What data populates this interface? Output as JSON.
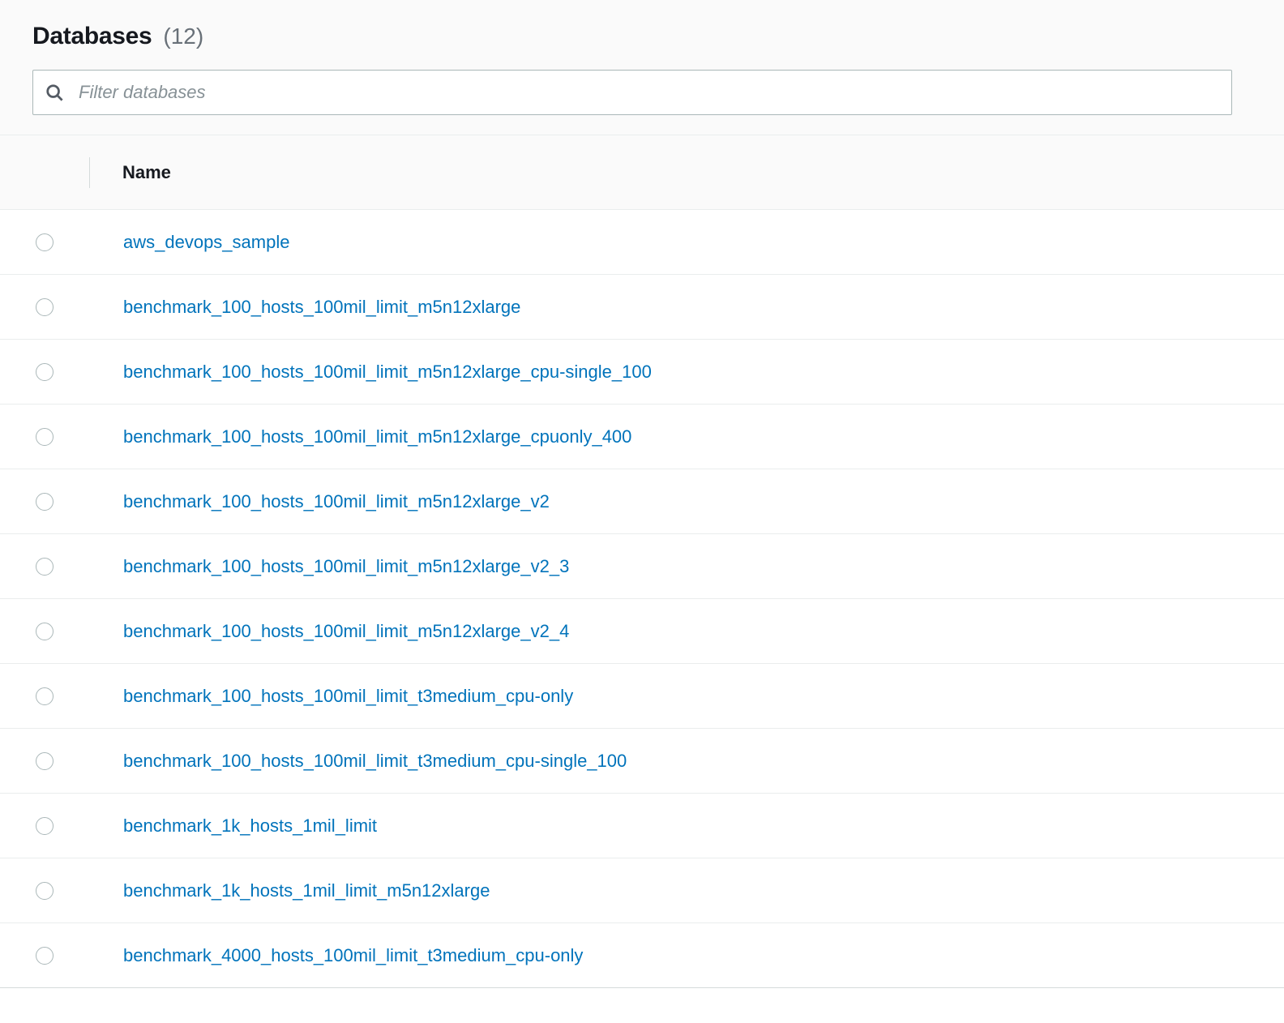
{
  "header": {
    "title": "Databases",
    "count": "(12)"
  },
  "filter": {
    "placeholder": "Filter databases",
    "value": ""
  },
  "columns": {
    "name": "Name"
  },
  "databases": [
    {
      "name": "aws_devops_sample"
    },
    {
      "name": "benchmark_100_hosts_100mil_limit_m5n12xlarge"
    },
    {
      "name": "benchmark_100_hosts_100mil_limit_m5n12xlarge_cpu-single_100"
    },
    {
      "name": "benchmark_100_hosts_100mil_limit_m5n12xlarge_cpuonly_400"
    },
    {
      "name": "benchmark_100_hosts_100mil_limit_m5n12xlarge_v2"
    },
    {
      "name": "benchmark_100_hosts_100mil_limit_m5n12xlarge_v2_3"
    },
    {
      "name": "benchmark_100_hosts_100mil_limit_m5n12xlarge_v2_4"
    },
    {
      "name": "benchmark_100_hosts_100mil_limit_t3medium_cpu-only"
    },
    {
      "name": "benchmark_100_hosts_100mil_limit_t3medium_cpu-single_100"
    },
    {
      "name": "benchmark_1k_hosts_1mil_limit"
    },
    {
      "name": "benchmark_1k_hosts_1mil_limit_m5n12xlarge"
    },
    {
      "name": "benchmark_4000_hosts_100mil_limit_t3medium_cpu-only"
    }
  ]
}
